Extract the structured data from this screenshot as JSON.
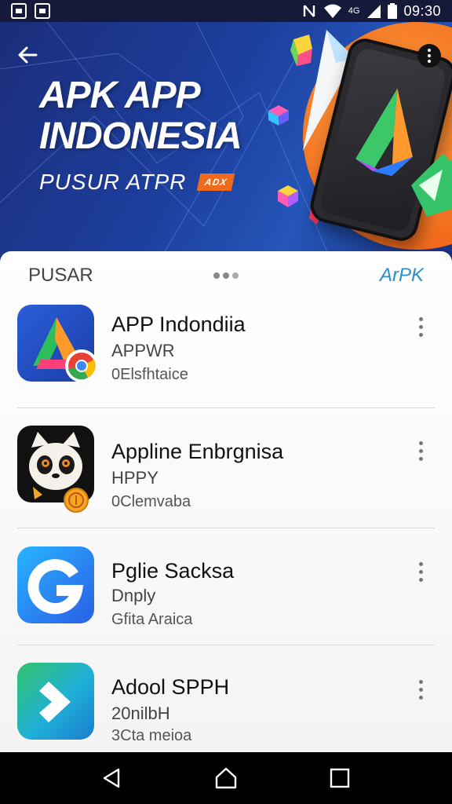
{
  "status_bar": {
    "time": "09:30",
    "signal_label": "4G"
  },
  "hero": {
    "title_line1": "APK APP",
    "title_line2": "INDONESIA",
    "subtitle": "PUSUR ATPR",
    "badge": "ADX",
    "back_icon": "arrow-left-icon",
    "menu_icon": "overflow-menu-icon"
  },
  "section": {
    "title": "PUSAR",
    "link": "ArPK"
  },
  "apps": [
    {
      "name": "APP Indondiia",
      "developer": "APPWR",
      "category": "0Elsfhtaice",
      "icon": "triangle-logo-icon"
    },
    {
      "name": "Appline Enbrgnisa",
      "developer": "HPPY",
      "category": "0Clemvaba",
      "icon": "panda-icon"
    },
    {
      "name": "Pglie Sacksa",
      "developer": "Dnply",
      "category": "Gfita Araica",
      "icon": "g-logo-icon"
    },
    {
      "name": "Adool SPPH",
      "developer": "20nilbH",
      "category": "3Cta meioa",
      "icon": "chevron-logo-icon"
    }
  ],
  "colors": {
    "hero_bg": "#1d3f9e",
    "accent_orange": "#f26b1c",
    "link_blue": "#2a8fd0"
  }
}
